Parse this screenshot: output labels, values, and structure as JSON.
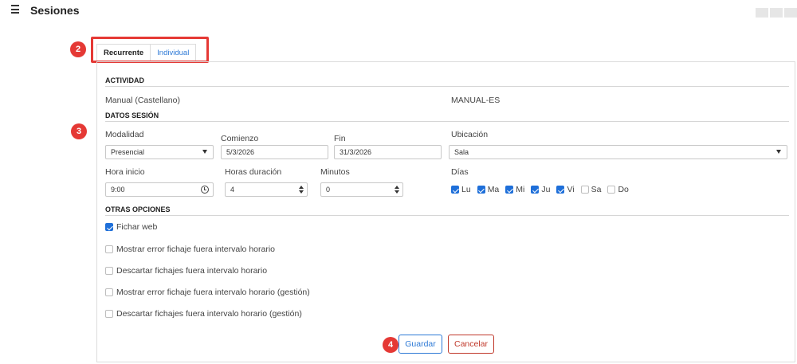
{
  "header": {
    "title": "Sesiones"
  },
  "tabs": [
    {
      "label": "Recurrente",
      "active": true
    },
    {
      "label": "Individual",
      "active": false
    }
  ],
  "badges": [
    "2",
    "3",
    "4"
  ],
  "actividad": {
    "heading": "ACTIVIDAD",
    "name": "Manual (Castellano)",
    "code": "MANUAL-ES"
  },
  "datos": {
    "heading": "DATOS SESIÓN",
    "modalidad_label": "Modalidad",
    "modalidad_value": "Presencial",
    "comienzo_label": "Comienzo",
    "comienzo_value": "5/3/2026",
    "fin_label": "Fin",
    "fin_value": "31/3/2026",
    "ubicacion_label": "Ubicación",
    "ubicacion_value": "Sala",
    "hora_inicio_label": "Hora inicio",
    "hora_inicio_value": "9:00",
    "horas_duracion_label": "Horas duración",
    "horas_duracion_value": "4",
    "minutos_label": "Minutos",
    "minutos_value": "0",
    "dias_label": "Días",
    "dias": [
      {
        "label": "Lu",
        "checked": true
      },
      {
        "label": "Ma",
        "checked": true
      },
      {
        "label": "Mi",
        "checked": true
      },
      {
        "label": "Ju",
        "checked": true
      },
      {
        "label": "Vi",
        "checked": true
      },
      {
        "label": "Sa",
        "checked": false
      },
      {
        "label": "Do",
        "checked": false
      }
    ]
  },
  "otras": {
    "heading": "OTRAS OPCIONES",
    "options": [
      {
        "label": "Fichar web",
        "checked": true
      },
      {
        "label": "Mostrar error fichaje fuera intervalo horario",
        "checked": false
      },
      {
        "label": "Descartar fichajes fuera intervalo horario",
        "checked": false
      },
      {
        "label": "Mostrar error fichaje fuera intervalo horario (gestión)",
        "checked": false
      },
      {
        "label": "Descartar fichajes fuera intervalo horario (gestión)",
        "checked": false
      }
    ]
  },
  "buttons": {
    "save": "Guardar",
    "cancel": "Cancelar"
  },
  "colors": {
    "accent": "#1e6fd9",
    "highlight": "#e53935",
    "cancel": "#c0392b"
  }
}
